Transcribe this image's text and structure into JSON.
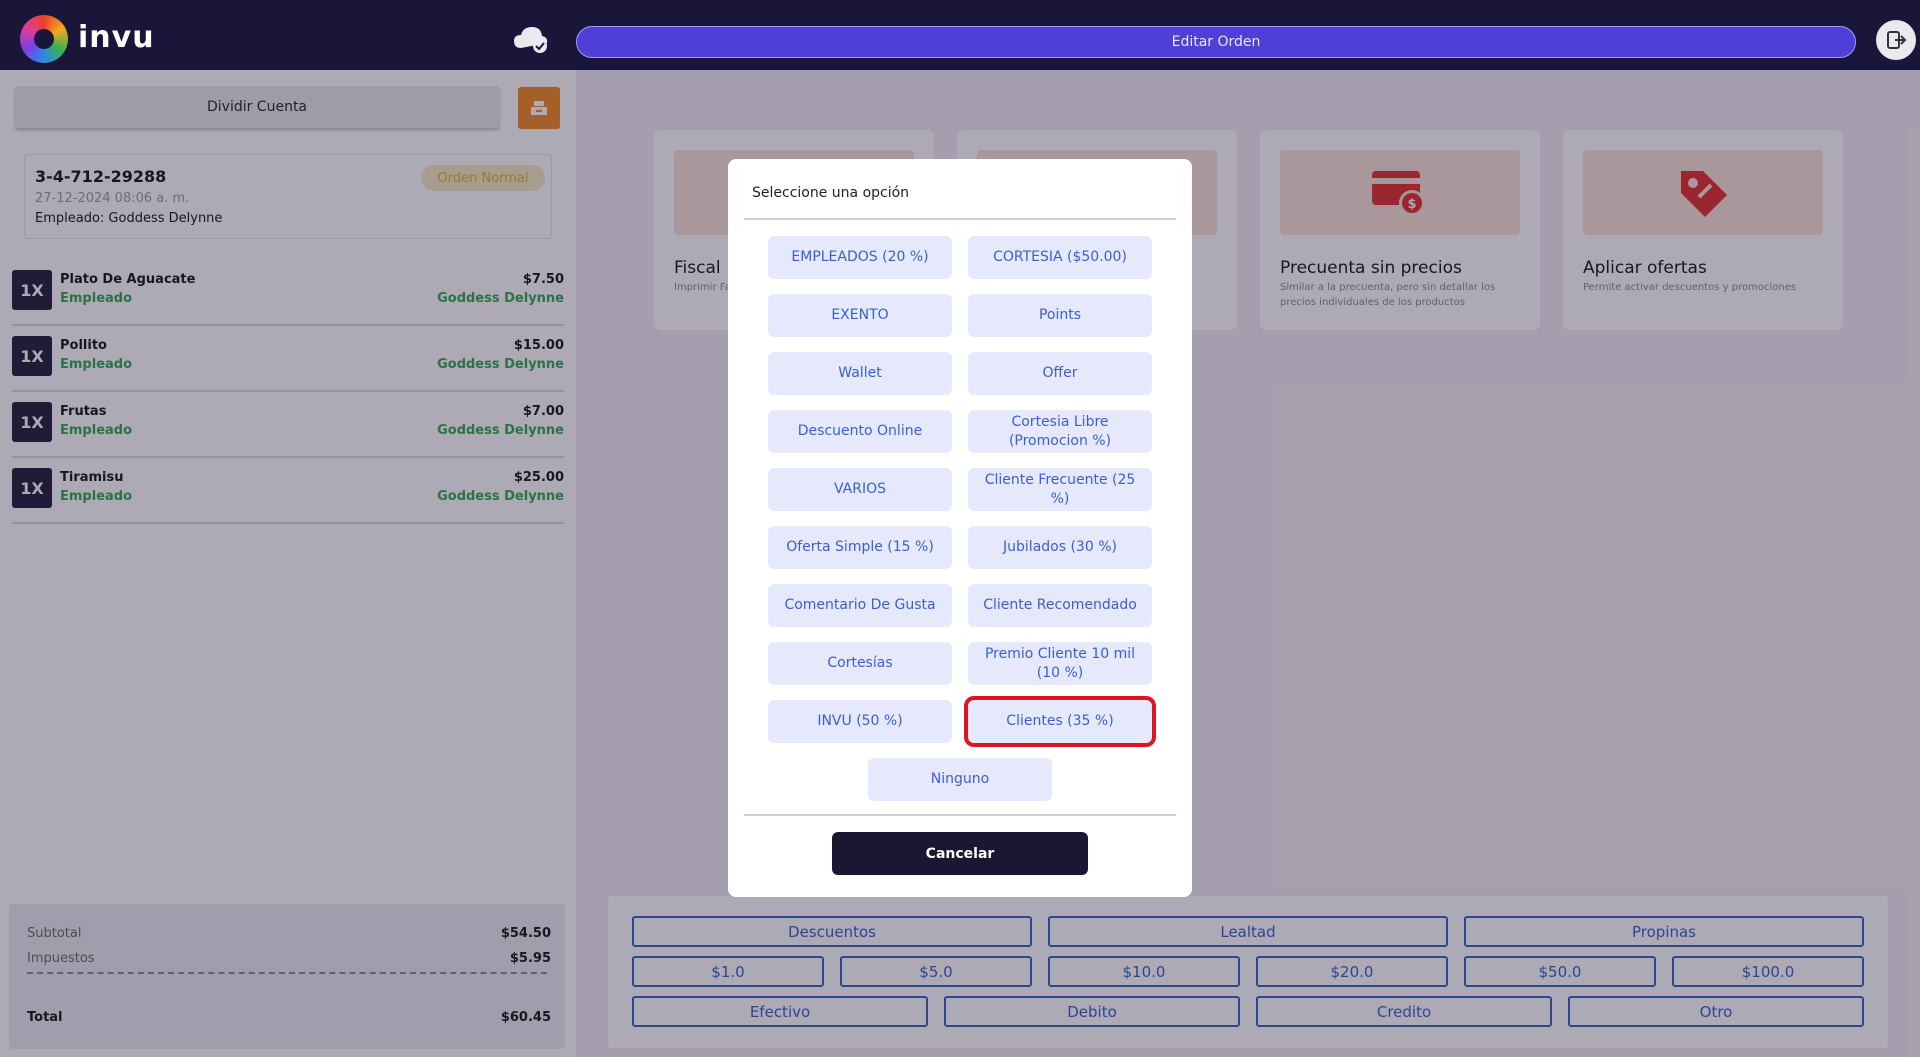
{
  "app": {
    "logo_text": "invu",
    "title": "Editar Orden"
  },
  "left": {
    "split_label": "Dividir Cuenta",
    "order": {
      "number": "3-4-712-29288",
      "date": "27-12-2024 08:06 a. m.",
      "employee": "Empleado: Goddess Delynne",
      "badge": "Orden Normal"
    },
    "items": [
      {
        "qty": "1X",
        "name": "Plato De Aguacate",
        "role": "Empleado",
        "price": "$7.50",
        "employee": "Goddess Delynne"
      },
      {
        "qty": "1X",
        "name": "Pollito",
        "role": "Empleado",
        "price": "$15.00",
        "employee": "Goddess Delynne"
      },
      {
        "qty": "1X",
        "name": "Frutas",
        "role": "Empleado",
        "price": "$7.00",
        "employee": "Goddess Delynne"
      },
      {
        "qty": "1X",
        "name": "Tiramisu",
        "role": "Empleado",
        "price": "$25.00",
        "employee": "Goddess Delynne"
      }
    ],
    "totals": {
      "subtotal_label": "Subtotal",
      "subtotal": "$54.50",
      "tax_label": "Impuestos",
      "tax": "$5.95",
      "total_label": "Total",
      "total": "$60.45"
    }
  },
  "options": [
    {
      "title": "Fiscal",
      "desc": "Imprimir Fa"
    },
    {
      "title": "",
      "desc": ""
    },
    {
      "title": "Precuenta sin precios",
      "desc": "Similar a la precuenta, pero sin detallar los precios individuales de los productos"
    },
    {
      "title": "Aplicar ofertas",
      "desc": "Permite activar descuentos y promociones"
    }
  ],
  "payments": {
    "row1": [
      "Descuentos",
      "Lealtad",
      "Propinas"
    ],
    "row2": [
      "$1.0",
      "$5.0",
      "$10.0",
      "$20.0",
      "$50.0",
      "$100.0"
    ],
    "row3": [
      "Efectivo",
      "Debito",
      "Credito",
      "Otro"
    ]
  },
  "dialog": {
    "title": "Seleccione una opción",
    "options": [
      "EMPLEADOS (20 %)",
      "CORTESIA ($50.00)",
      "EXENTO",
      "Points",
      "Wallet",
      "Offer",
      "Descuento Online",
      "Cortesia Libre (Promocion %)",
      "VARIOS",
      "Cliente Frecuente (25 %)",
      "Oferta Simple (15 %)",
      "Jubilados (30 %)",
      "Comentario De Gusta",
      "Cliente Recomendado",
      "Cortesías",
      "Premio Cliente 10 mil (10 %)",
      "INVU (50 %)",
      "Clientes (35 %)"
    ],
    "none_label": "Ninguno",
    "cancel_label": "Cancelar",
    "selected": "Clientes (35 %)"
  },
  "colors": {
    "topbar": "#19163a",
    "accent": "#4f3fd6",
    "dialog_button_text": "#3b5fcf",
    "selection": "#e0141e",
    "green": "#2ea84a"
  }
}
